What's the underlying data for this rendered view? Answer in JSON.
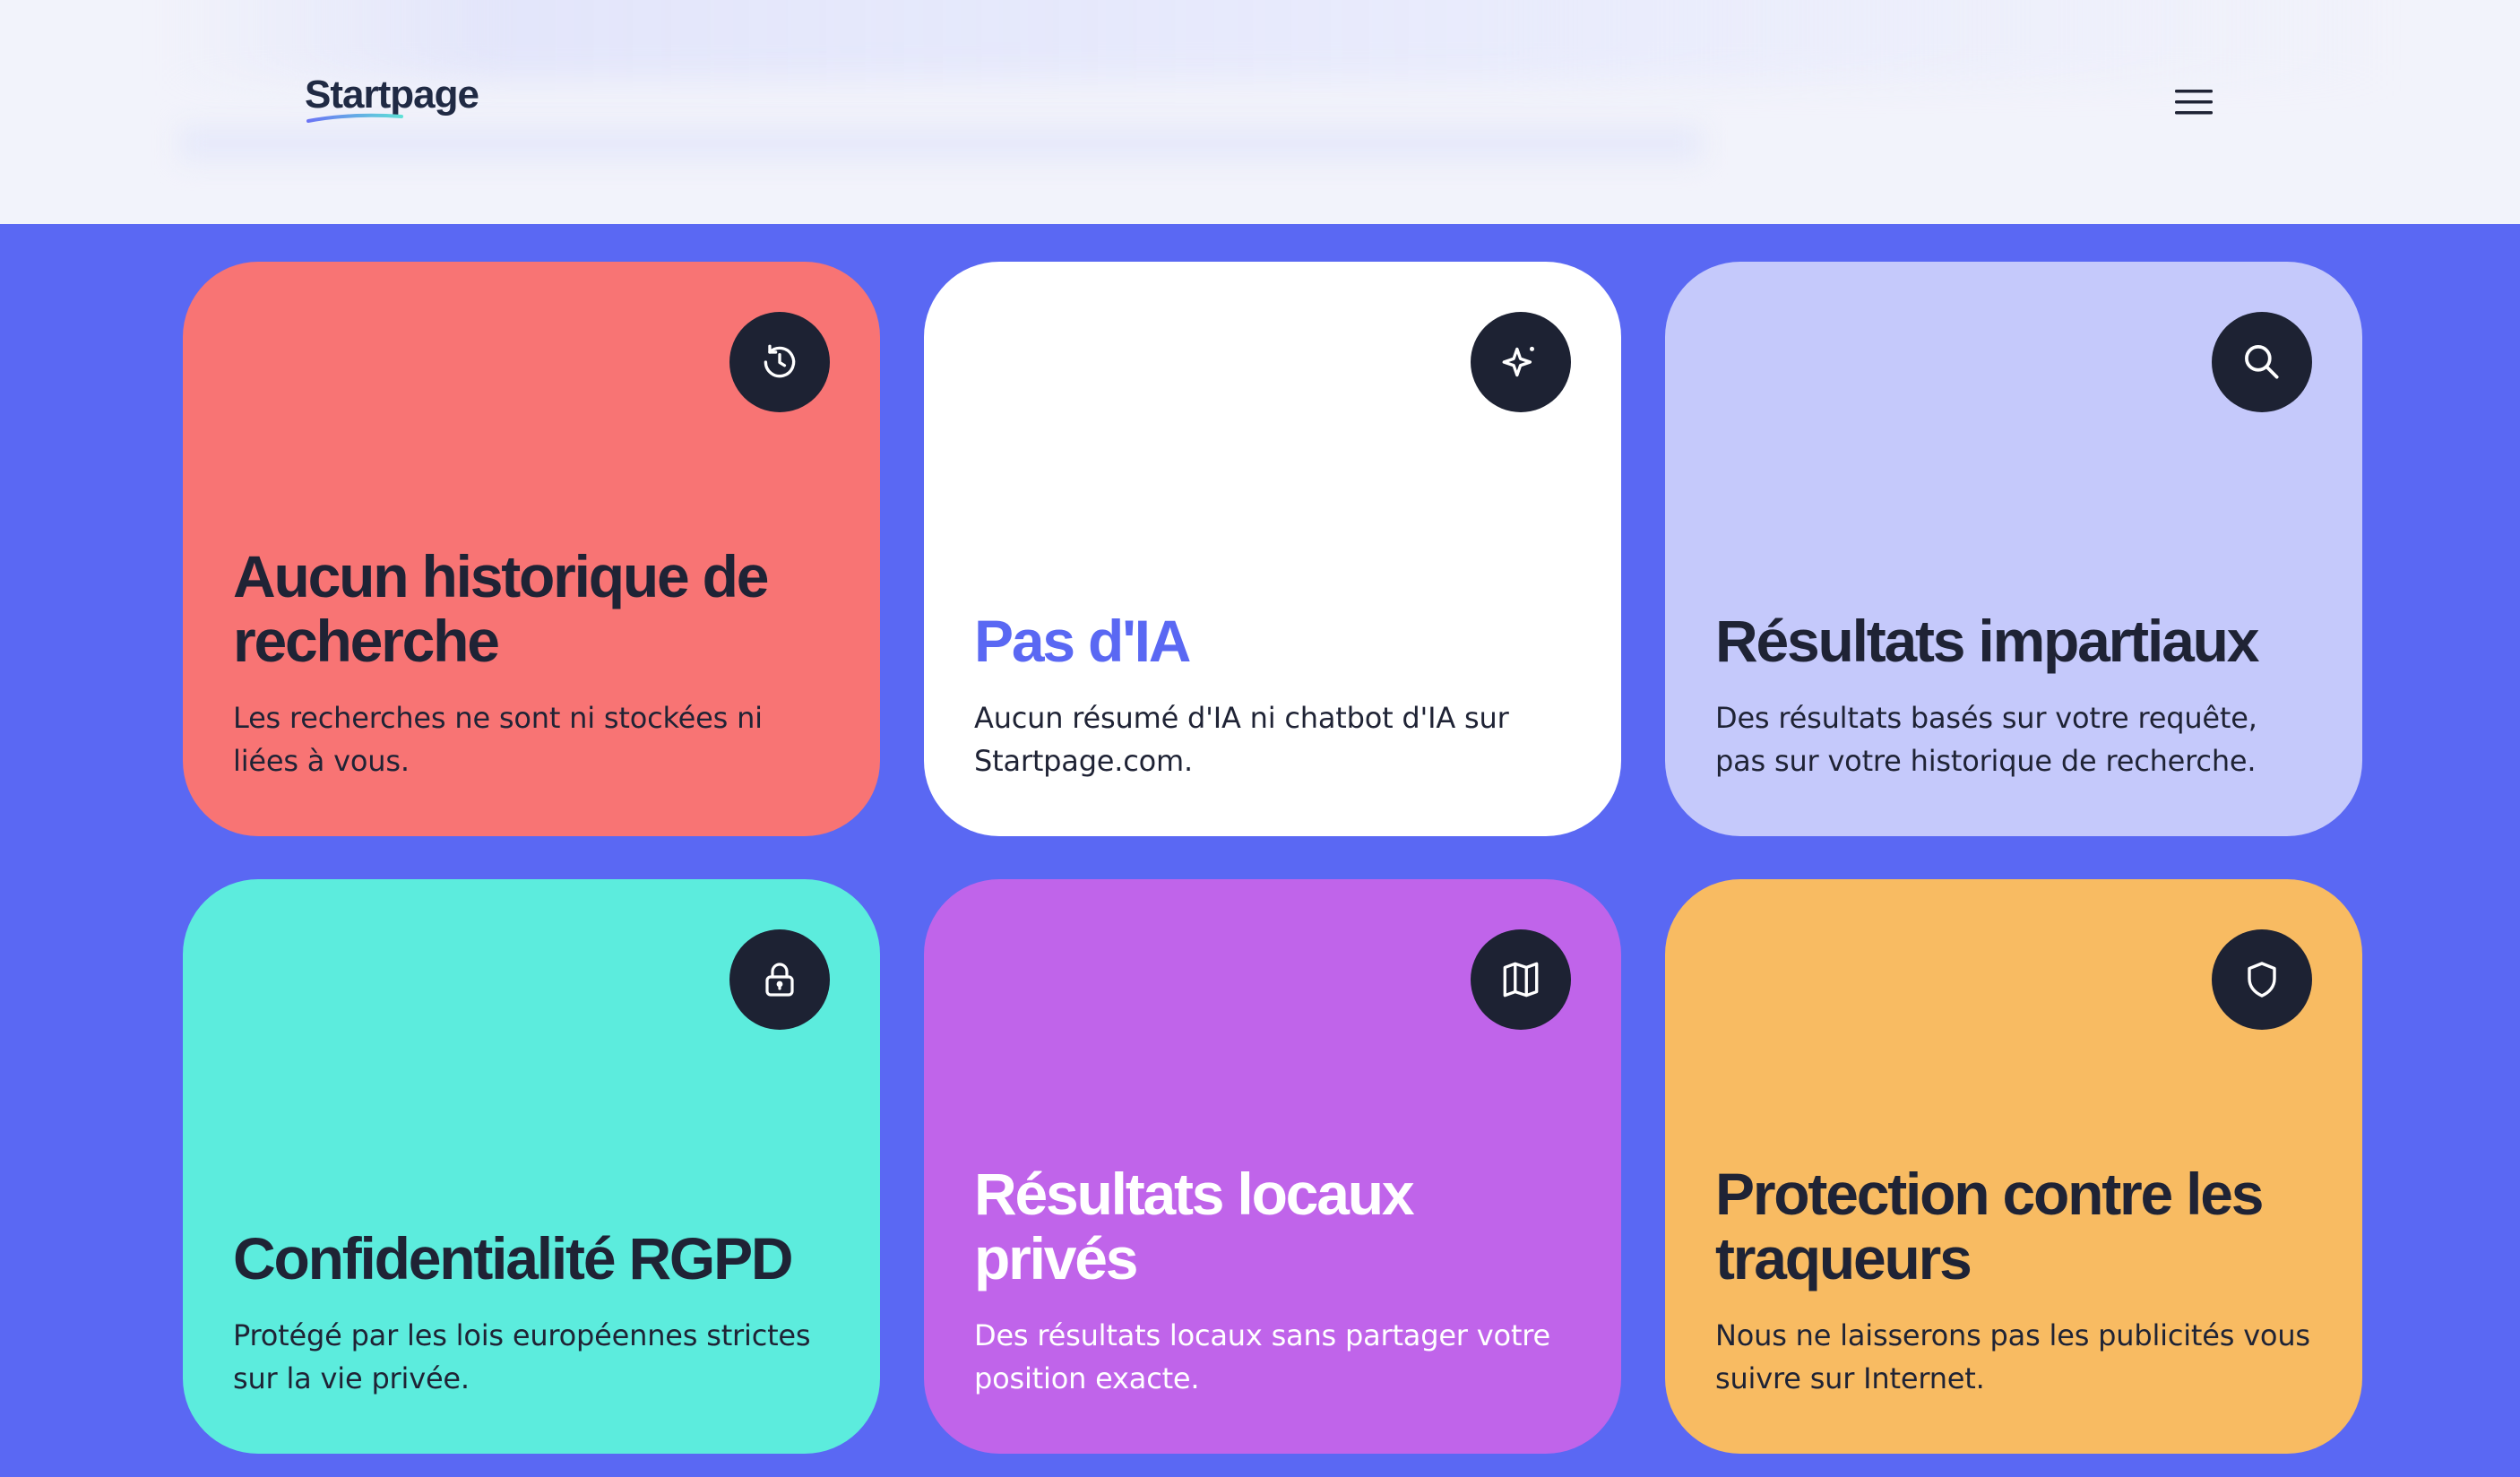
{
  "header": {
    "logo_text": "Startpage",
    "menu_icon": "hamburger-menu-icon"
  },
  "colors": {
    "page_background": "#5a68f3",
    "header_background": "#f2f3fb",
    "icon_circle": "#1d2233",
    "dark_text": "#1f2335",
    "accent_purple": "#5a68f3"
  },
  "cards": [
    {
      "title": "Aucun historique de recherche",
      "description": "Les recherches ne sont ni stockées ni liées à vous.",
      "icon": "history-icon",
      "background": "#f87474",
      "title_color": "#1f2335",
      "text_color": "#1f2335"
    },
    {
      "title": "Pas d'IA",
      "description": "Aucun résumé d'IA ni chatbot d'IA sur Startpage.com.",
      "icon": "sparkle-icon",
      "background": "#ffffff",
      "title_color": "#5a68f3",
      "text_color": "#1f2335"
    },
    {
      "title": "Résultats impartiaux",
      "description": "Des résultats basés sur votre requête, pas sur votre historique de recherche.",
      "icon": "search-icon",
      "background": "#c5c9fb",
      "title_color": "#1f2335",
      "text_color": "#1f2335"
    },
    {
      "title": "Confidentialité RGPD",
      "description": "Protégé par les lois européennes strictes sur la vie privée.",
      "icon": "lock-icon",
      "background": "#5cecdd",
      "title_color": "#1f2335",
      "text_color": "#1f2335"
    },
    {
      "title": "Résultats locaux privés",
      "description": "Des résultats locaux sans partager votre position exacte.",
      "icon": "map-icon",
      "background": "#c064ea",
      "title_color": "#ffffff",
      "text_color": "#ffffff"
    },
    {
      "title": "Protection contre les traqueurs",
      "description": "Nous ne laisserons pas les publicités vous suivre sur Internet.",
      "icon": "shield-icon",
      "background": "#f8bb62",
      "title_color": "#1f2335",
      "text_color": "#1f2335"
    }
  ]
}
